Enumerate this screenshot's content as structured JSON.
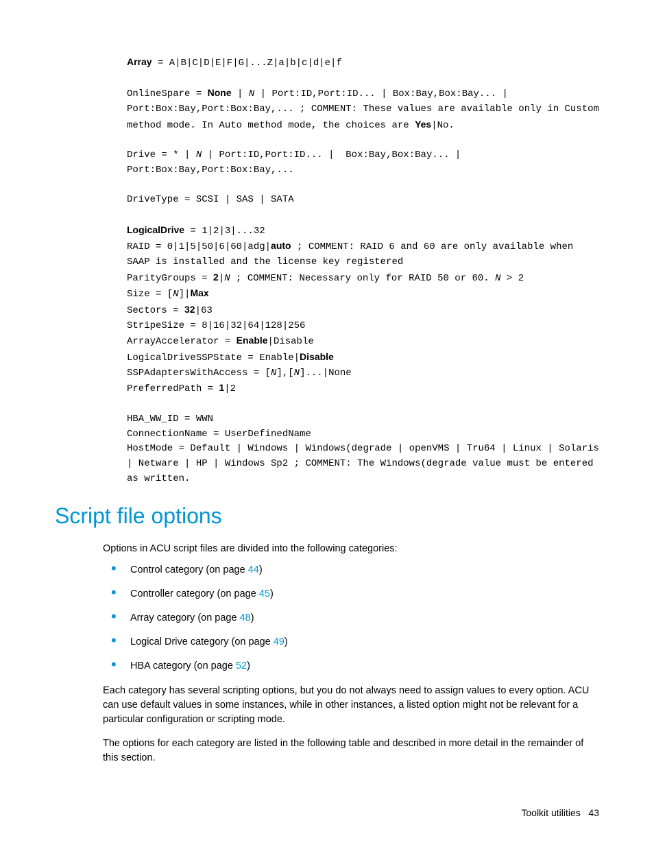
{
  "code": {
    "array_label": "Array",
    "array_rest": " = A|B|C|D|E|F|G|...Z|a|b|c|d|e|f",
    "online_pre": "OnlineSpare = ",
    "online_none": "None",
    "online_mid": " | ",
    "online_n": "N",
    "online_rest1": " | Port:ID,Port:ID... | Box:Bay,Box:Bay... | Port:Box:Bay,Port:Box:Bay,... ; COMMENT: These values are available only in Custom method mode. In Auto method mode, the choices are ",
    "online_yes": "Yes",
    "online_end": "|No.",
    "drive_line": "Drive = * | ",
    "drive_n": "N",
    "drive_rest": " | Port:ID,Port:ID... |  Box:Bay,Box:Bay... | Port:Box:Bay,Port:Box:Bay,...",
    "drivetype": "DriveType = SCSI | SAS | SATA",
    "logical_label": "LogicalDrive",
    "logical_rest": " = 1|2|3|...32",
    "raid_pre": "RAID = 0|1|5|50|6|60|adg|",
    "raid_auto": "auto",
    "raid_rest": " ; COMMENT: RAID 6 and 60 are only available when SAAP is installed and the license key registered",
    "parity_pre": "ParityGroups = ",
    "parity_2": "2",
    "parity_mid": "|",
    "parity_n": "N",
    "parity_rest": " ; COMMENT: Necessary only for RAID 50 or 60. ",
    "parity_n2": "N",
    "parity_end": " > 2",
    "size_pre": "Size = [",
    "size_n": "N",
    "size_mid": "]|",
    "size_max": "Max",
    "sectors_pre": "Sectors = ",
    "sectors_32": "32",
    "sectors_rest": "|63",
    "stripe": "StripeSize = 8|16|32|64|128|256",
    "accel_pre": "ArrayAccelerator = ",
    "accel_enable": "Enable",
    "accel_rest": "|Disable",
    "ssp_pre": "LogicalDriveSSPState = Enable|",
    "ssp_disable": "Disable",
    "sspa_pre": "SSPAdaptersWithAccess = [",
    "sspa_n1": "N",
    "sspa_mid": "],[",
    "sspa_n2": "N",
    "sspa_rest": "]...|None",
    "pref_pre": "PreferredPath = ",
    "pref_1": "1",
    "pref_rest": "|2",
    "hba": "HBA_WW_ID = WWN",
    "conn": "ConnectionName = UserDefinedName",
    "host": "HostMode = Default | Windows | Windows(degrade | openVMS | Tru64 | Linux | Solaris | Netware | HP | Windows Sp2 ; COMMENT: The Windows(degrade value must be entered as written."
  },
  "section": {
    "title": "Script file options",
    "intro": "Options in ACU script files are divided into the following categories:",
    "items": [
      {
        "label": "Control category (on page ",
        "page": "44",
        "post": ")"
      },
      {
        "label": "Controller category (on page ",
        "page": "45",
        "post": ")"
      },
      {
        "label": "Array category (on page ",
        "page": "48",
        "post": ")"
      },
      {
        "label": "Logical Drive category (on page ",
        "page": "49",
        "post": ")"
      },
      {
        "label": "HBA category (on page ",
        "page": "52",
        "post": ")"
      }
    ],
    "para2": "Each category has several scripting options, but you do not always need to assign values to every option. ACU can use default values in some instances, while in other instances, a listed option might not be relevant for a particular configuration or scripting mode.",
    "para3": "The options for each category are listed in the following table and described in more detail in the remainder of this section."
  },
  "footer": {
    "text": "Toolkit utilities",
    "page": "43"
  }
}
